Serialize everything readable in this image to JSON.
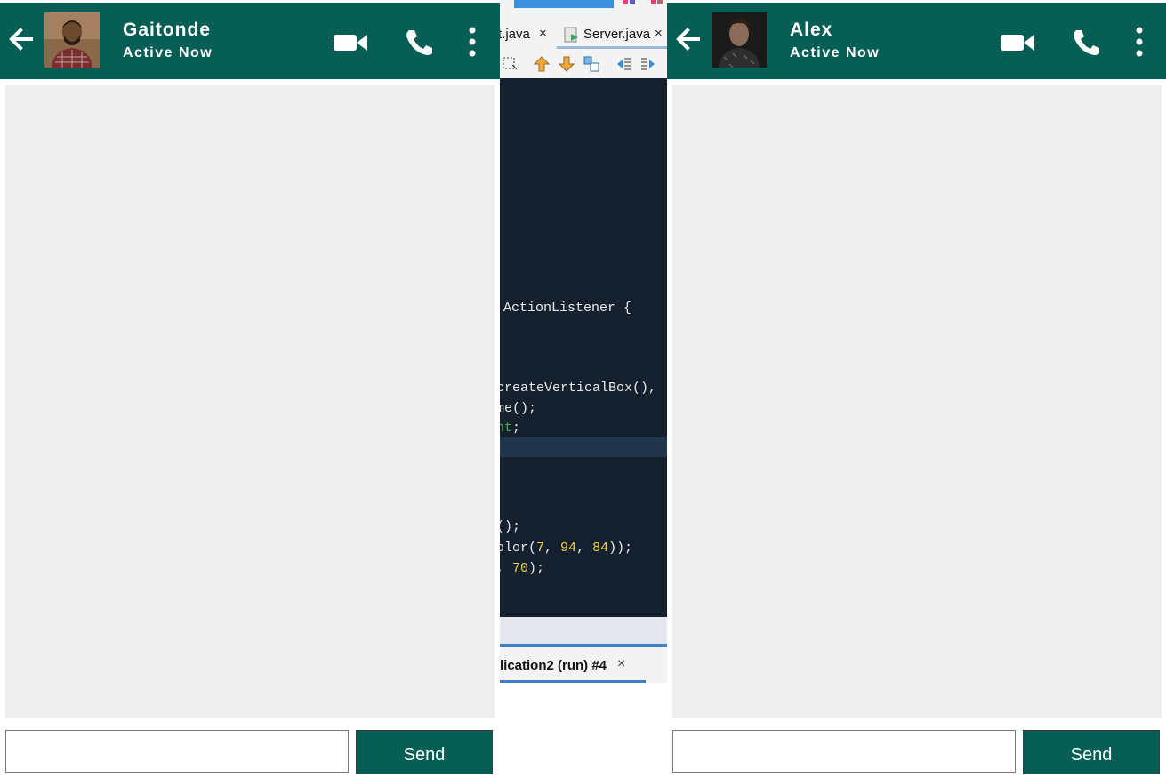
{
  "left_chat": {
    "contact_name": "Gaitonde",
    "status": "Active Now",
    "input_value": "",
    "send_label": "Send"
  },
  "right_chat": {
    "contact_name": "Alex",
    "status": "Active Now",
    "input_value": "",
    "send_label": "Send"
  },
  "ide": {
    "tabs": [
      {
        "label": "t.java",
        "close": "×"
      },
      {
        "label": "Server.java",
        "close": "×"
      }
    ],
    "code_lines": {
      "l1": "ActionListener {",
      "l2": "createVerticalBox(),",
      "l3": "me();",
      "l4_a": "nt",
      "l4_b": ";",
      "l5": "();",
      "l6_a": "olor(",
      "l6_n1": "7",
      "l6_c1": ", ",
      "l6_n2": "94",
      "l6_c2": ", ",
      "l6_n3": "84",
      "l6_e": "));",
      "l7_a": ", ",
      "l7_n": "70",
      "l7_e": ");"
    },
    "output_tab": {
      "label": "lication2 (run) #4",
      "close": "×"
    }
  },
  "colors": {
    "header": "#075e54",
    "send_button": "#075e54",
    "message_area": "#eeeeee",
    "editor_bg": "#15202f"
  },
  "icons": [
    "back-arrow-icon",
    "video-call-icon",
    "phone-icon",
    "more-options-icon"
  ]
}
